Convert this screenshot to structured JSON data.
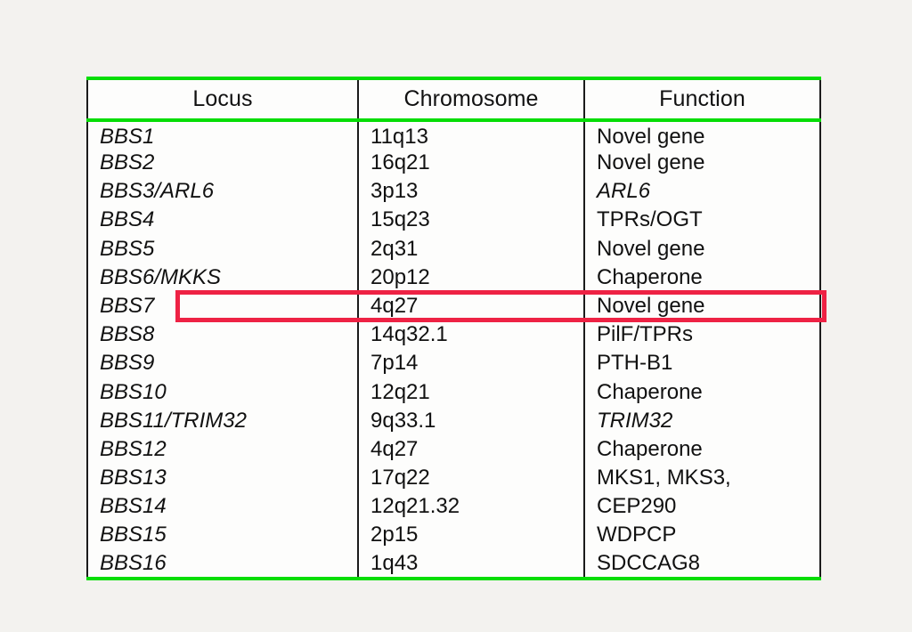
{
  "table": {
    "columns": [
      {
        "key": "locus",
        "label": "Locus"
      },
      {
        "key": "chrom",
        "label": "Chromosome"
      },
      {
        "key": "func",
        "label": "Function"
      }
    ],
    "rows": [
      {
        "locus": "BBS1",
        "locus_italic": true,
        "chrom": "11q13",
        "func": "Novel gene",
        "func_italic": false
      },
      {
        "locus": "BBS2",
        "locus_italic": true,
        "chrom": "16q21",
        "func": "Novel gene",
        "func_italic": false
      },
      {
        "locus": "BBS3/ARL6",
        "locus_italic": true,
        "chrom": "3p13",
        "func": "ARL6",
        "func_italic": true
      },
      {
        "locus": "BBS4",
        "locus_italic": true,
        "chrom": "15q23",
        "func": "TPRs/OGT",
        "func_italic": false
      },
      {
        "locus": "BBS5",
        "locus_italic": true,
        "chrom": "2q31",
        "func": "Novel gene",
        "func_italic": false
      },
      {
        "locus": "BBS6/MKKS",
        "locus_italic": true,
        "chrom": "20p12",
        "func": "Chaperone",
        "func_italic": false
      },
      {
        "locus": "BBS7",
        "locus_italic": true,
        "chrom": "4q27",
        "func": "Novel gene",
        "func_italic": false
      },
      {
        "locus": "BBS8",
        "locus_italic": true,
        "chrom": "14q32.1",
        "func": "PilF/TPRs",
        "func_italic": false
      },
      {
        "locus": "BBS9",
        "locus_italic": true,
        "chrom": "7p14",
        "func": "PTH-B1",
        "func_italic": false
      },
      {
        "locus": "BBS10",
        "locus_italic": true,
        "chrom": "12q21",
        "func": "Chaperone",
        "func_italic": false
      },
      {
        "locus": "BBS11/TRIM32",
        "locus_italic": true,
        "chrom": "9q33.1",
        "func": "TRIM32",
        "func_italic": true
      },
      {
        "locus": "BBS12",
        "locus_italic": true,
        "chrom": "4q27",
        "func": "Chaperone",
        "func_italic": false
      },
      {
        "locus": "BBS13",
        "locus_italic": true,
        "chrom": "17q22",
        "func": "MKS1, MKS3,",
        "func_italic": false
      },
      {
        "locus": "BBS14",
        "locus_italic": true,
        "chrom": "12q21.32",
        "func": "CEP290",
        "func_italic": false
      },
      {
        "locus": "BBS15",
        "locus_italic": true,
        "chrom": "2p15",
        "func": "WDPCP",
        "func_italic": false
      },
      {
        "locus": "BBS16",
        "locus_italic": true,
        "chrom": "1q43",
        "func": "SDCCAG8",
        "func_italic": false
      }
    ],
    "highlight": {
      "row_index": 6,
      "row_locus": "BBS7",
      "color": "#ee2244"
    },
    "colors": {
      "border_green": "#05dd05",
      "border_dark": "#1b1b1b",
      "text": "#111111",
      "page_background": "#f3f2ef",
      "table_background": "#fdfdfc"
    }
  }
}
